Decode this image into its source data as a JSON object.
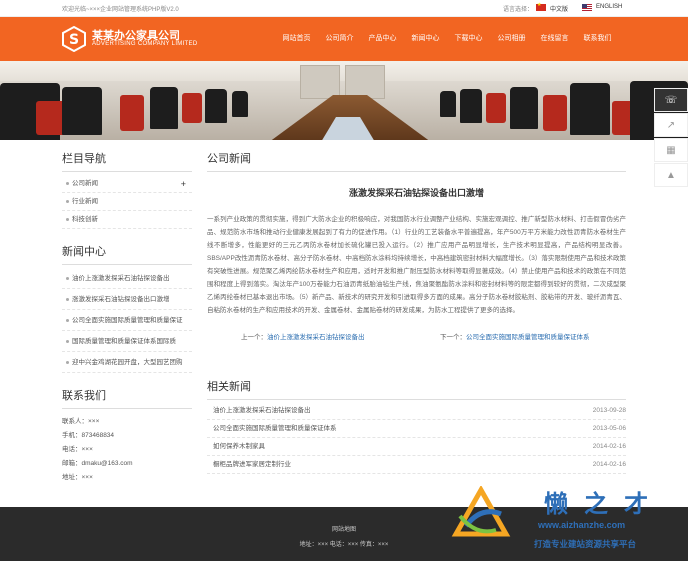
{
  "topbar": {
    "welcome": "欢迎光临~×××企业网站管理系统PHP版V2.0",
    "lang_label": "语言选择：",
    "lang_cn": "中文版",
    "lang_en": "ENGLISH"
  },
  "header": {
    "company_name": "某某办公家具公司",
    "company_en": "ADVERTISING COMPANY LIMITED",
    "brand_color": "#f26522",
    "nav": [
      "网站首页",
      "公司简介",
      "产品中心",
      "新闻中心",
      "下载中心",
      "公司相册",
      "在线留言",
      "联系我们"
    ]
  },
  "sidebar": {
    "category_title": "栏目导航",
    "categories": [
      "公司新闻",
      "行业新闻",
      "科技创新"
    ],
    "news_title": "新闻中心",
    "news": [
      "油价上涨激发探采石油钻探设备出",
      "涨激发探采石油钻探设备出口激增",
      "公司全面实施国际质量管理和质量保证",
      "国际质量管理和质量保证体系国际质",
      "迎中兴金鸡湖花园开盘，大型园艺团购"
    ],
    "contact_title": "联系我们",
    "contact": [
      "联系人：×××",
      "手机：873468834",
      "电话：×××",
      "邮箱：dmaku@163.com",
      "地址：×××"
    ]
  },
  "main": {
    "section_title": "公司新闻",
    "article_title": "涨激发探采石油钻探设备出口激增",
    "article_body": "一系列产业政策的贯彻实施，得到广大防水企业的积极响应，对我国防水行业调整产业结构、实施宏观调控、推广新型防水材料、打击假冒伪劣产品、规范防水市场和推动行业健康发展起到了有力的促进作用。（1）行业的工艺装备水平普遍提高，年产500万平方米能力改性沥青防水卷材生产线不断增多，性能更好的三元乙丙防水卷材加长硫化罐已投入运行。（2）推广应用产品明显增长，生产技术明显提高，产品结构明显改善。SBS/APP改性沥青防水卷材、高分子防水卷材、中高档防水涂料均持续增长，中高档建筑密封材料大幅度增长。（3）落实限制使用产品和技术政策有突破性进展。规范聚乙烯丙纶防水卷材生产和应用，适时开发和推广耐压型防水材料等取得显著成效。（4）禁止使用产品和技术的政策在不同范围和程度上得到落实。淘汰年产100万卷能力石油沥青纸胎油毡生产线，焦油聚氨酯防水涂料和密封材料等的限定都得到较好的贯彻，二次成型聚乙烯丙纶卷材已基本退出市场。（5）新产品、新技术的研究开发和引进取得多方面的成果。高分子防水卷材胶粘剂、胶粘带的开发、玻纤沥青瓦、自粘防水卷材的生产和应用技术的开发、金属卷材、金属贴卷材的研发成果，为防水工程提供了更多的选择。",
    "prev_label": "上一个：",
    "prev_link": "油价上涨激发探采石油钻探设备出",
    "next_label": "下一个：",
    "next_link": "公司全面实施国际质量管理和质量保证体系",
    "link_color": "#2a6db0"
  },
  "related": {
    "title": "相关新闻",
    "items": [
      {
        "title": "油价上涨激发探采石油钻探设备出",
        "date": "2013-09-28"
      },
      {
        "title": "公司全面实施国际质量管理和质量保证体系",
        "date": "2013-05-06"
      },
      {
        "title": "如何保养木制家具",
        "date": "2014-02-16"
      },
      {
        "title": "橱柜品牌进军家居定制行业",
        "date": "2014-02-16"
      }
    ]
  },
  "footer": {
    "sitemap": "网站地图",
    "contact": "地址：××× 电话：××× 传真：×××"
  },
  "watermark": {
    "brand": "懒之才",
    "url": "www.aizhanzhe.com",
    "slogan": "打造专业建站资源共享平台"
  }
}
